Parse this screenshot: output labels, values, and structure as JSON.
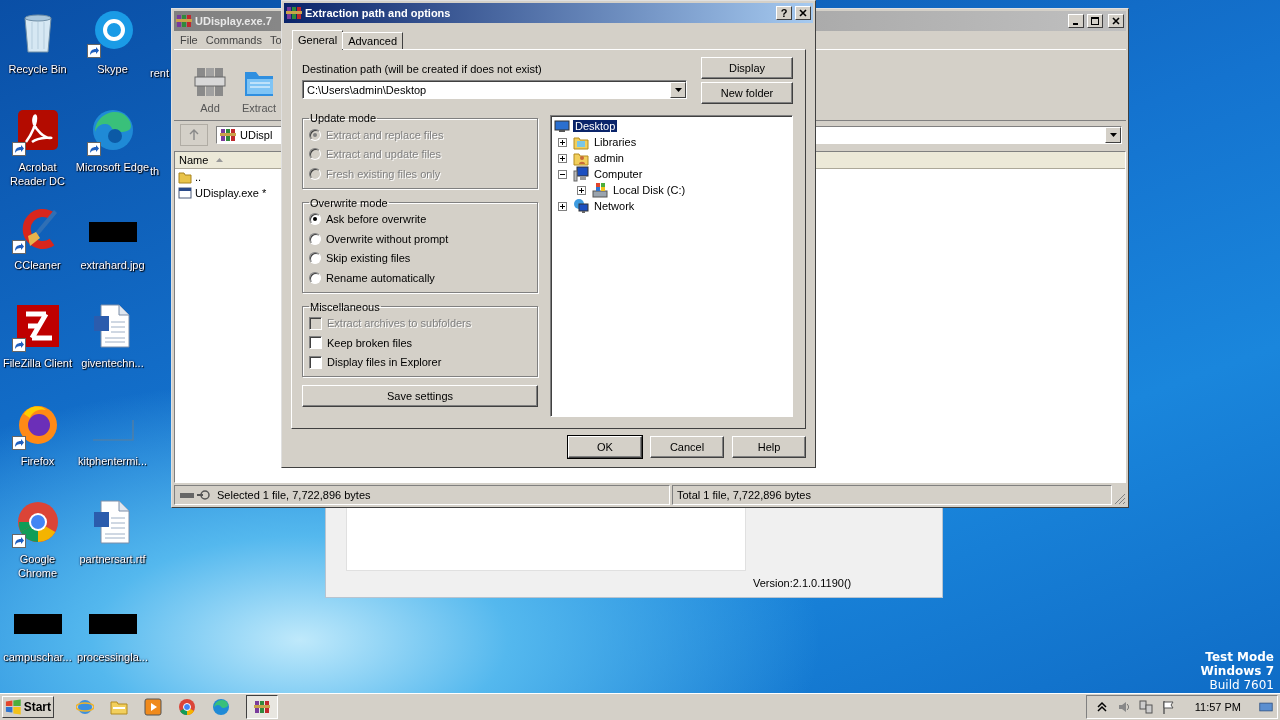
{
  "desktop": {
    "icons": [
      {
        "label": "Recycle Bin",
        "kind": "recycle",
        "shortcut": false
      },
      {
        "label": "Acrobat Reader DC",
        "kind": "acrobat",
        "shortcut": true
      },
      {
        "label": "CCleaner",
        "kind": "ccleaner",
        "shortcut": true
      },
      {
        "label": "FileZilla Client",
        "kind": "filezilla",
        "shortcut": true
      },
      {
        "label": "Firefox",
        "kind": "firefox",
        "shortcut": true
      },
      {
        "label": "Google Chrome",
        "kind": "chrome",
        "shortcut": true
      },
      {
        "label": "campuschar...",
        "kind": "redacted",
        "shortcut": false
      },
      {
        "label": "Skype",
        "kind": "skype",
        "shortcut": true
      },
      {
        "label": "Microsoft Edge",
        "kind": "edge",
        "shortcut": true
      },
      {
        "label": "extrahard.jpg",
        "kind": "redacted",
        "shortcut": false
      },
      {
        "label": "giventechn...",
        "kind": "word",
        "shortcut": false
      },
      {
        "label": "kitphentermi...",
        "kind": "blank",
        "shortcut": false
      },
      {
        "label": "partnersart.rtf",
        "kind": "word",
        "shortcut": false
      },
      {
        "label": "processingla...",
        "kind": "redacted",
        "shortcut": false
      },
      {
        "label": "rent",
        "kind": "cut"
      },
      {
        "label": "th",
        "kind": "cut"
      }
    ],
    "test_mode": [
      {
        "text": "Test Mode",
        "strong": true
      },
      {
        "text": "Windows 7",
        "strong": true
      },
      {
        "text": "Build 7601",
        "strong": false
      }
    ]
  },
  "version_window": {
    "version": "Version:2.1.0.1190()"
  },
  "archive_window": {
    "title": "UDisplay.exe.7",
    "menu": [
      "File",
      "Commands",
      "To"
    ],
    "toolbar": [
      {
        "label": "Add",
        "kind": "add"
      },
      {
        "label": "Extract",
        "kind": "extract"
      }
    ],
    "address": "UDispl",
    "columns": [
      "Name"
    ],
    "files": [
      {
        "name": "..",
        "kind": "up"
      },
      {
        "name": "UDisplay.exe *",
        "kind": "exe"
      }
    ],
    "status": [
      "Selected 1 file, 7,722,896 bytes",
      "Total 1 file, 7,722,896 bytes"
    ]
  },
  "dialog": {
    "title": "Extraction path and options",
    "help_glyph": "?",
    "tabs": [
      {
        "label": "General",
        "selected": true
      },
      {
        "label": "Advanced",
        "selected": false
      }
    ],
    "destination": {
      "label": "Destination path (will be created if does not exist)",
      "value": "C:\\Users\\admin\\Desktop"
    },
    "side_buttons": [
      "Display",
      "New folder"
    ],
    "groups": [
      {
        "title": "Update mode",
        "items": [
          {
            "kind": "radio",
            "label": "Extract and replace files",
            "selected": true,
            "disabled": true
          },
          {
            "kind": "radio",
            "label": "Extract and update files",
            "selected": false,
            "disabled": true
          },
          {
            "kind": "radio",
            "label": "Fresh existing files only",
            "selected": false,
            "disabled": true
          }
        ]
      },
      {
        "title": "Overwrite mode",
        "items": [
          {
            "kind": "radio",
            "label": "Ask before overwrite",
            "selected": true,
            "disabled": false
          },
          {
            "kind": "radio",
            "label": "Overwrite without prompt",
            "selected": false,
            "disabled": false
          },
          {
            "kind": "radio",
            "label": "Skip existing files",
            "selected": false,
            "disabled": false
          },
          {
            "kind": "radio",
            "label": "Rename automatically",
            "selected": false,
            "disabled": false
          }
        ]
      },
      {
        "title": "Miscellaneous",
        "items": [
          {
            "kind": "checkbox",
            "label": "Extract archives to subfolders",
            "checked": false,
            "disabled": true
          },
          {
            "kind": "checkbox",
            "label": "Keep broken files",
            "checked": false,
            "disabled": false
          },
          {
            "kind": "checkbox",
            "label": "Display files in Explorer",
            "checked": false,
            "disabled": false
          }
        ]
      }
    ],
    "save_button": "Save settings",
    "tree": [
      {
        "label": "Desktop",
        "kind": "desktop",
        "selected": true,
        "children": [
          {
            "label": "Libraries",
            "kind": "library",
            "selected": false,
            "expanded": false
          },
          {
            "label": "admin",
            "kind": "user",
            "selected": false,
            "expanded": false
          },
          {
            "label": "Computer",
            "kind": "computer",
            "selected": false,
            "expanded": true,
            "children": [
              {
                "label": "Local Disk (C:)",
                "kind": "disk",
                "selected": false,
                "expanded": false
              }
            ]
          },
          {
            "label": "Network",
            "kind": "network",
            "selected": false,
            "expanded": false
          }
        ]
      }
    ],
    "footer_buttons": [
      {
        "label": "OK",
        "default": true
      },
      {
        "label": "Cancel",
        "default": false
      },
      {
        "label": "Help",
        "default": false
      }
    ]
  },
  "taskbar": {
    "start": "Start",
    "apps": [
      {
        "kind": "ie",
        "active": false
      },
      {
        "kind": "explorer",
        "active": false
      },
      {
        "kind": "media",
        "active": false
      },
      {
        "kind": "chrome",
        "active": false
      },
      {
        "kind": "edge",
        "active": false
      },
      {
        "kind": "winrar",
        "active": true
      }
    ],
    "clock": "11:57 PM"
  }
}
